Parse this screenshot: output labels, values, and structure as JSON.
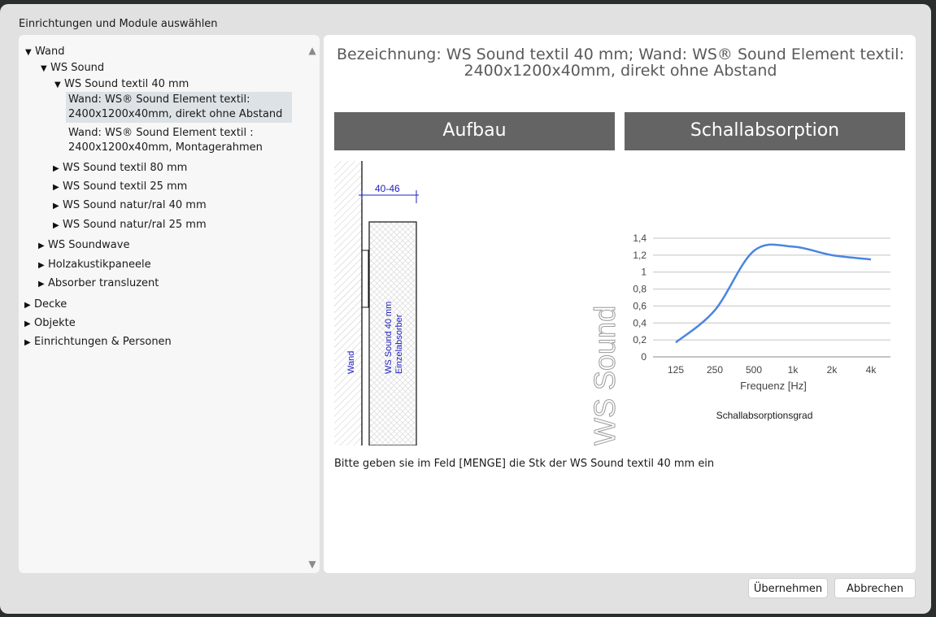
{
  "dialog": {
    "title": "Einrichtungen und Module auswählen",
    "ok_label": "Übernehmen",
    "cancel_label": "Abbrechen"
  },
  "tree": {
    "wand": "Wand",
    "ws_sound": "WS Sound",
    "ws_sound_textil_40": "WS Sound textil 40 mm",
    "leaf_1": "Wand: WS® Sound Element textil: 2400x1200x40mm, direkt ohne Abstand",
    "leaf_2": "Wand: WS® Sound Element textil : 2400x1200x40mm, Montagerahmen",
    "ws_sound_textil_80": "WS Sound textil 80 mm",
    "ws_sound_textil_25": "WS Sound textil 25 mm",
    "ws_sound_natur_40": "WS Sound natur/ral 40 mm",
    "ws_sound_natur_25": "WS Sound natur/ral 25 mm",
    "ws_soundwave": "WS Soundwave",
    "holzakustik": "Holzakustikpaneele",
    "absorber": "Absorber transluzent",
    "decke": "Decke",
    "objekte": "Objekte",
    "einrichtungen": "Einrichtungen & Personen"
  },
  "detail": {
    "bezeichnung_line1": "Bezeichnung: WS Sound textil 40 mm; Wand: WS® Sound Element textil:",
    "bezeichnung_line2": "2400x1200x40mm, direkt ohne Abstand",
    "aufbau_header": "Aufbau",
    "schall_header": "Schallabsorption",
    "instruction": "Bitte geben sie im Feld [MENGE] die Stk der WS Sound textil 40 mm ein"
  },
  "aufbau": {
    "dimension": "40-46",
    "wall_label": "Wand",
    "panel_label_1": "WS Sound 40 mm",
    "panel_label_2": "Einzelabsorber"
  },
  "brand_text": "WS Sound",
  "chart_data": {
    "type": "line",
    "title": "",
    "xlabel": "Frequenz [Hz]",
    "ylabel": "",
    "caption": "Schallabsorptionsgrad",
    "categories": [
      "125",
      "250",
      "500",
      "1k",
      "2k",
      "4k"
    ],
    "values": [
      0.17,
      0.55,
      1.25,
      1.3,
      1.2,
      1.15
    ],
    "ylim": [
      0,
      1.4
    ],
    "yticks": [
      "0",
      "0,2",
      "0,4",
      "0,6",
      "0,8",
      "1",
      "1,2",
      "1,4"
    ],
    "grid": true,
    "line_color": "#4a86e0"
  }
}
